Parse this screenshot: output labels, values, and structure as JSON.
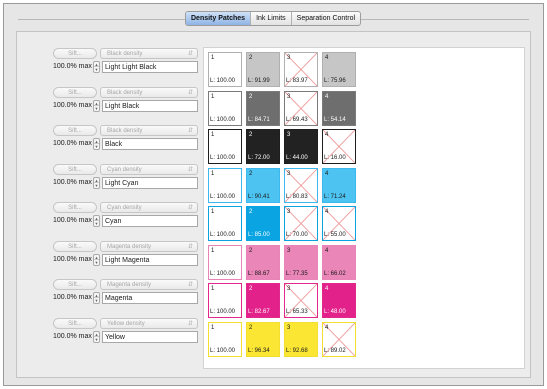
{
  "tabs": [
    {
      "label": "Density Patches",
      "active": true
    },
    {
      "label": "Ink Limits",
      "active": false
    },
    {
      "label": "Separation Control",
      "active": false
    }
  ],
  "sift_label": "Sift...",
  "channels": [
    {
      "density": "Black density",
      "max": "100.0% max",
      "name": "Light Light Black"
    },
    {
      "density": "Black density",
      "max": "100.0% max",
      "name": "Light Black"
    },
    {
      "density": "Black density",
      "max": "100.0% max",
      "name": "Black"
    },
    {
      "density": "Cyan density",
      "max": "100.0% max",
      "name": "Light Cyan"
    },
    {
      "density": "Cyan density",
      "max": "100.0% max",
      "name": "Cyan"
    },
    {
      "density": "Magenta density",
      "max": "100.0% max",
      "name": "Light Magenta"
    },
    {
      "density": "Magenta density",
      "max": "100.0% max",
      "name": "Magenta"
    },
    {
      "density": "Yellow density",
      "max": "100.0% max",
      "name": "Yellow"
    }
  ],
  "patch_rows": [
    {
      "border": "#b0b0b0",
      "patches": [
        {
          "num": "1",
          "label": "L: 100.00",
          "fill": "#ffffff",
          "text": "#1a1a1a",
          "crossed": false
        },
        {
          "num": "2",
          "label": "L: 91.99",
          "fill": "#c6c6c6",
          "text": "#1a1a1a",
          "crossed": false
        },
        {
          "num": "3",
          "label": "L: 83.97",
          "fill": "#ffffff",
          "text": "#1a1a1a",
          "crossed": true
        },
        {
          "num": "4",
          "label": "L: 75.96",
          "fill": "#c6c6c6",
          "text": "#1a1a1a",
          "crossed": false
        }
      ]
    },
    {
      "border": "#7a7a7a",
      "patches": [
        {
          "num": "1",
          "label": "L: 100.00",
          "fill": "#ffffff",
          "text": "#1a1a1a",
          "crossed": false
        },
        {
          "num": "2",
          "label": "L: 84.71",
          "fill": "#6e6e6e",
          "text": "#ffffff",
          "crossed": false
        },
        {
          "num": "3",
          "label": "L: 69.43",
          "fill": "#ffffff",
          "text": "#1a1a1a",
          "crossed": true
        },
        {
          "num": "4",
          "label": "L: 54.14",
          "fill": "#6e6e6e",
          "text": "#ffffff",
          "crossed": false
        }
      ]
    },
    {
      "border": "#1e1e1e",
      "patches": [
        {
          "num": "1",
          "label": "L: 100.00",
          "fill": "#ffffff",
          "text": "#1a1a1a",
          "crossed": false
        },
        {
          "num": "2",
          "label": "L: 72.00",
          "fill": "#222222",
          "text": "#ffffff",
          "crossed": false
        },
        {
          "num": "3",
          "label": "L: 44.00",
          "fill": "#222222",
          "text": "#ffffff",
          "crossed": false
        },
        {
          "num": "4",
          "label": "L: 16.00",
          "fill": "#ffffff",
          "text": "#1a1a1a",
          "crossed": true
        }
      ]
    },
    {
      "border": "#3cb8ee",
      "patches": [
        {
          "num": "1",
          "label": "L: 100.00",
          "fill": "#ffffff",
          "text": "#1a1a1a",
          "crossed": false
        },
        {
          "num": "2",
          "label": "L: 90.41",
          "fill": "#4cc3f0",
          "text": "#1a1a1a",
          "crossed": false
        },
        {
          "num": "3",
          "label": "L: 80.83",
          "fill": "#ffffff",
          "text": "#1a1a1a",
          "crossed": true
        },
        {
          "num": "4",
          "label": "L: 71.24",
          "fill": "#4cc3f0",
          "text": "#1a1a1a",
          "crossed": false
        }
      ]
    },
    {
      "border": "#0aa2e0",
      "patches": [
        {
          "num": "1",
          "label": "L: 100.00",
          "fill": "#ffffff",
          "text": "#1a1a1a",
          "crossed": false
        },
        {
          "num": "2",
          "label": "L: 85.00",
          "fill": "#0aa4e2",
          "text": "#ffffff",
          "crossed": false
        },
        {
          "num": "3",
          "label": "L: 70.00",
          "fill": "#ffffff",
          "text": "#1a1a1a",
          "crossed": true
        },
        {
          "num": "4",
          "label": "L: 55.00",
          "fill": "#ffffff",
          "text": "#1a1a1a",
          "crossed": true
        }
      ]
    },
    {
      "border": "#e884b8",
      "patches": [
        {
          "num": "1",
          "label": "L: 100.00",
          "fill": "#ffffff",
          "text": "#1a1a1a",
          "crossed": false
        },
        {
          "num": "2",
          "label": "L: 88.67",
          "fill": "#ea86b8",
          "text": "#1a1a1a",
          "crossed": false
        },
        {
          "num": "3",
          "label": "L: 77.35",
          "fill": "#ea86b8",
          "text": "#1a1a1a",
          "crossed": false
        },
        {
          "num": "4",
          "label": "L: 66.02",
          "fill": "#ea86b8",
          "text": "#1a1a1a",
          "crossed": false
        }
      ]
    },
    {
      "border": "#e2288a",
      "patches": [
        {
          "num": "1",
          "label": "L: 100.00",
          "fill": "#ffffff",
          "text": "#1a1a1a",
          "crossed": false
        },
        {
          "num": "2",
          "label": "L: 82.67",
          "fill": "#e3218b",
          "text": "#ffffff",
          "crossed": false
        },
        {
          "num": "3",
          "label": "L: 65.33",
          "fill": "#ffffff",
          "text": "#1a1a1a",
          "crossed": true
        },
        {
          "num": "4",
          "label": "L: 48.00",
          "fill": "#e3218b",
          "text": "#ffffff",
          "crossed": false
        }
      ]
    },
    {
      "border": "#f2df30",
      "patches": [
        {
          "num": "1",
          "label": "L: 100.00",
          "fill": "#ffffff",
          "text": "#1a1a1a",
          "crossed": false
        },
        {
          "num": "2",
          "label": "L: 96.34",
          "fill": "#fbe733",
          "text": "#1a1a1a",
          "crossed": false
        },
        {
          "num": "3",
          "label": "L: 92.68",
          "fill": "#fbe733",
          "text": "#1a1a1a",
          "crossed": false
        },
        {
          "num": "4",
          "label": "L: 89.02",
          "fill": "#ffffff",
          "text": "#1a1a1a",
          "crossed": true
        }
      ]
    }
  ],
  "cross_color": "#ef9a9a",
  "icons": {
    "stepper": "stepper-arrows-icon",
    "popup": "popup-arrows-icon"
  }
}
